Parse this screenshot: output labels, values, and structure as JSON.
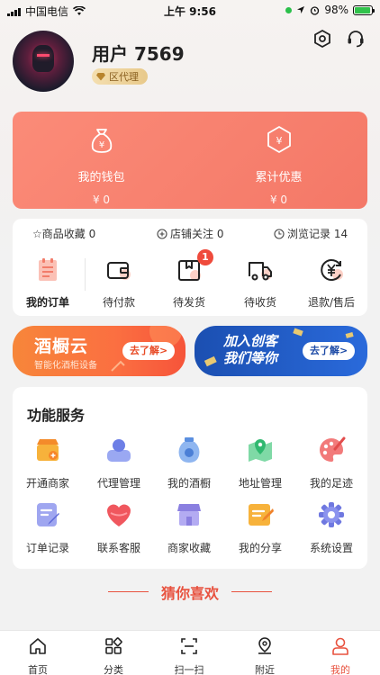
{
  "status_bar": {
    "carrier": "中国电信",
    "time": "上午 9:56",
    "battery": "98%"
  },
  "profile": {
    "username": "用户 7569",
    "role": "区代理"
  },
  "wallet": {
    "items": [
      {
        "label": "我的钱包",
        "value": "¥ 0"
      },
      {
        "label": "累计优惠",
        "value": "¥ 0"
      }
    ]
  },
  "stats": {
    "favorites": "☆商品收藏 0",
    "follows": "店铺关注 0",
    "history": "浏览记录 14"
  },
  "orders": {
    "items": [
      {
        "label": "我的订单"
      },
      {
        "label": "待付款"
      },
      {
        "label": "待发货",
        "badge": "1"
      },
      {
        "label": "待收货"
      },
      {
        "label": "退款/售后"
      }
    ]
  },
  "banners": {
    "left": {
      "title": "酒橱云",
      "subtitle": "智能化酒柜设备",
      "button": "去了解>"
    },
    "right": {
      "title_line1": "加入创客",
      "title_line2": "我们等你",
      "button": "去了解>"
    }
  },
  "services": {
    "title": "功能服务",
    "items": [
      {
        "label": "开通商家",
        "icon": "shop-icon"
      },
      {
        "label": "代理管理",
        "icon": "user-icon"
      },
      {
        "label": "我的酒橱",
        "icon": "wine-jar-icon"
      },
      {
        "label": "地址管理",
        "icon": "map-pin-icon"
      },
      {
        "label": "我的足迹",
        "icon": "palette-icon"
      },
      {
        "label": "订单记录",
        "icon": "order-note-icon"
      },
      {
        "label": "联系客服",
        "icon": "heart-icon"
      },
      {
        "label": "商家收藏",
        "icon": "store-icon"
      },
      {
        "label": "我的分享",
        "icon": "share-icon"
      },
      {
        "label": "系统设置",
        "icon": "gear-icon"
      }
    ]
  },
  "guess": "猜你喜欢",
  "tabs": [
    {
      "label": "首页"
    },
    {
      "label": "分类"
    },
    {
      "label": "扫一扫"
    },
    {
      "label": "附近"
    },
    {
      "label": "我的"
    }
  ],
  "colors": {
    "accent": "#e8523f",
    "wallet_card": "#f47867",
    "banner_orange": "#f7863a",
    "banner_blue": "#1b4fb1"
  }
}
